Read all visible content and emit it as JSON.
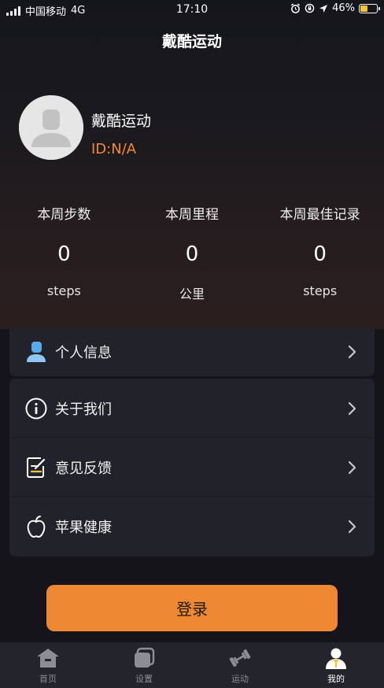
{
  "status_bar": {
    "carrier": "中国移动",
    "network": "4G",
    "time": "17:10",
    "battery_percent": "46%",
    "battery_level": 0.46
  },
  "nav": {
    "title": "戴酷运动"
  },
  "profile": {
    "username": "戴酷运动",
    "user_id": "ID:N/A",
    "avatar_icon": "default-avatar-icon"
  },
  "stats": [
    {
      "label": "本周步数",
      "value": "0",
      "unit": "steps"
    },
    {
      "label": "本周里程",
      "value": "0",
      "unit": "公里"
    },
    {
      "label": "本周最佳记录",
      "value": "0",
      "unit": "steps"
    }
  ],
  "menu": {
    "personal_info": {
      "label": "个人信息",
      "icon": "person-icon"
    },
    "items": [
      {
        "label": "关于我们",
        "icon": "info-icon"
      },
      {
        "label": "意见反馈",
        "icon": "feedback-icon"
      },
      {
        "label": "苹果健康",
        "icon": "apple-icon"
      }
    ]
  },
  "login_button": {
    "label": "登录"
  },
  "tabs": [
    {
      "label": "首页",
      "icon": "home-icon",
      "active": false
    },
    {
      "label": "设置",
      "icon": "settings-icon",
      "active": false
    },
    {
      "label": "运动",
      "icon": "dumbbell-icon",
      "active": false
    },
    {
      "label": "我的",
      "icon": "profile-icon",
      "active": true
    }
  ],
  "colors": {
    "accent": "#ef8833",
    "user_id": "#ef8a33",
    "background": "#14141a",
    "card": "#22232a",
    "tab_bar": "#24252c"
  }
}
